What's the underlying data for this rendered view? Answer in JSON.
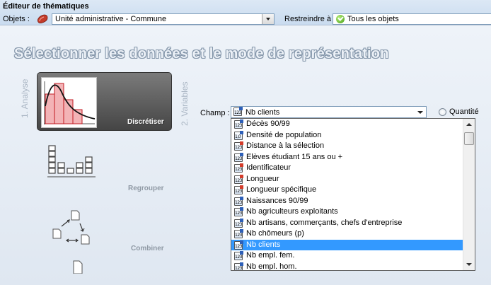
{
  "window": {
    "title": "Éditeur de thématiques"
  },
  "toolbar": {
    "objets_label": "Objets :",
    "objets_value": "Unité administrative - Commune",
    "restreindre_label": "Restreindre à :",
    "restreindre_value": "Tous les objets"
  },
  "main": {
    "title": "Sélectionner les données et le mode de représentation"
  },
  "steps": {
    "analyse": "1. Analyse",
    "variables": "2. Variables"
  },
  "modes": [
    {
      "label": "Discrétiser",
      "selected": true
    },
    {
      "label": "Regrouper",
      "selected": false
    },
    {
      "label": "Combiner",
      "selected": false
    }
  ],
  "champ": {
    "label": "Champ :",
    "value": "Nb clients",
    "option_label": "Quantité"
  },
  "dropdown": {
    "items": [
      {
        "label": "Décès 90/99",
        "icon": "integer-field-icon"
      },
      {
        "label": "Densité de population",
        "icon": "decimal-field-icon"
      },
      {
        "label": "Distance à la sélection",
        "icon": "calculated-field-icon"
      },
      {
        "label": "Elèves étudiant 15 ans ou +",
        "icon": "integer-field-icon"
      },
      {
        "label": "Identificateur",
        "icon": "key-field-icon"
      },
      {
        "label": "Longueur",
        "icon": "calculated-field-icon"
      },
      {
        "label": "Longueur spécifique",
        "icon": "calculated-field-icon"
      },
      {
        "label": "Naissances 90/99",
        "icon": "integer-field-icon"
      },
      {
        "label": "Nb agriculteurs exploitants",
        "icon": "integer-field-icon"
      },
      {
        "label": "Nb artisans, commerçants, chefs d'entreprise",
        "icon": "integer-field-icon"
      },
      {
        "label": "Nb chômeurs (p)",
        "icon": "integer-field-icon"
      },
      {
        "label": "Nb clients",
        "icon": "integer-field-icon"
      },
      {
        "label": "Nb empl. fem.",
        "icon": "integer-field-icon"
      },
      {
        "label": "Nb empl. hom.",
        "icon": "integer-field-icon"
      }
    ],
    "selected_index": 11
  },
  "icon_text": {
    "integer": "123",
    "decimal": "1,0"
  },
  "colors": {
    "selection": "#3399ff",
    "tile_dark": "#454545",
    "title_outline": "#8496aa",
    "histogram": "#f3b3b6",
    "histogram_stroke": "#c11b23",
    "red_badge": "#d43b2a",
    "blue_badge": "#2d5fb8"
  }
}
